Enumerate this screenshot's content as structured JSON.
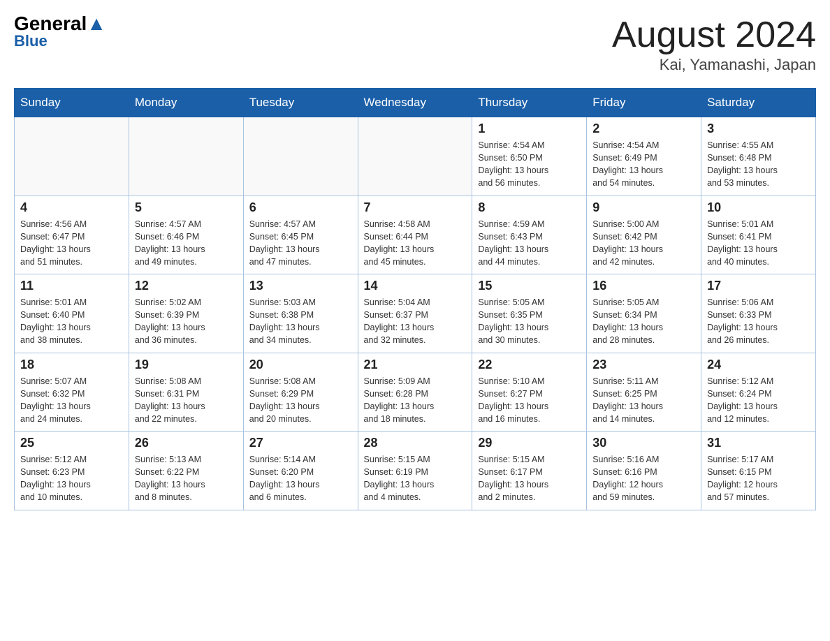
{
  "logo": {
    "line1_black": "General",
    "line1_blue": "Blue",
    "line2": "Blue"
  },
  "title": "August 2024",
  "subtitle": "Kai, Yamanashi, Japan",
  "weekdays": [
    "Sunday",
    "Monday",
    "Tuesday",
    "Wednesday",
    "Thursday",
    "Friday",
    "Saturday"
  ],
  "weeks": [
    [
      {
        "day": "",
        "info": ""
      },
      {
        "day": "",
        "info": ""
      },
      {
        "day": "",
        "info": ""
      },
      {
        "day": "",
        "info": ""
      },
      {
        "day": "1",
        "info": "Sunrise: 4:54 AM\nSunset: 6:50 PM\nDaylight: 13 hours\nand 56 minutes."
      },
      {
        "day": "2",
        "info": "Sunrise: 4:54 AM\nSunset: 6:49 PM\nDaylight: 13 hours\nand 54 minutes."
      },
      {
        "day": "3",
        "info": "Sunrise: 4:55 AM\nSunset: 6:48 PM\nDaylight: 13 hours\nand 53 minutes."
      }
    ],
    [
      {
        "day": "4",
        "info": "Sunrise: 4:56 AM\nSunset: 6:47 PM\nDaylight: 13 hours\nand 51 minutes."
      },
      {
        "day": "5",
        "info": "Sunrise: 4:57 AM\nSunset: 6:46 PM\nDaylight: 13 hours\nand 49 minutes."
      },
      {
        "day": "6",
        "info": "Sunrise: 4:57 AM\nSunset: 6:45 PM\nDaylight: 13 hours\nand 47 minutes."
      },
      {
        "day": "7",
        "info": "Sunrise: 4:58 AM\nSunset: 6:44 PM\nDaylight: 13 hours\nand 45 minutes."
      },
      {
        "day": "8",
        "info": "Sunrise: 4:59 AM\nSunset: 6:43 PM\nDaylight: 13 hours\nand 44 minutes."
      },
      {
        "day": "9",
        "info": "Sunrise: 5:00 AM\nSunset: 6:42 PM\nDaylight: 13 hours\nand 42 minutes."
      },
      {
        "day": "10",
        "info": "Sunrise: 5:01 AM\nSunset: 6:41 PM\nDaylight: 13 hours\nand 40 minutes."
      }
    ],
    [
      {
        "day": "11",
        "info": "Sunrise: 5:01 AM\nSunset: 6:40 PM\nDaylight: 13 hours\nand 38 minutes."
      },
      {
        "day": "12",
        "info": "Sunrise: 5:02 AM\nSunset: 6:39 PM\nDaylight: 13 hours\nand 36 minutes."
      },
      {
        "day": "13",
        "info": "Sunrise: 5:03 AM\nSunset: 6:38 PM\nDaylight: 13 hours\nand 34 minutes."
      },
      {
        "day": "14",
        "info": "Sunrise: 5:04 AM\nSunset: 6:37 PM\nDaylight: 13 hours\nand 32 minutes."
      },
      {
        "day": "15",
        "info": "Sunrise: 5:05 AM\nSunset: 6:35 PM\nDaylight: 13 hours\nand 30 minutes."
      },
      {
        "day": "16",
        "info": "Sunrise: 5:05 AM\nSunset: 6:34 PM\nDaylight: 13 hours\nand 28 minutes."
      },
      {
        "day": "17",
        "info": "Sunrise: 5:06 AM\nSunset: 6:33 PM\nDaylight: 13 hours\nand 26 minutes."
      }
    ],
    [
      {
        "day": "18",
        "info": "Sunrise: 5:07 AM\nSunset: 6:32 PM\nDaylight: 13 hours\nand 24 minutes."
      },
      {
        "day": "19",
        "info": "Sunrise: 5:08 AM\nSunset: 6:31 PM\nDaylight: 13 hours\nand 22 minutes."
      },
      {
        "day": "20",
        "info": "Sunrise: 5:08 AM\nSunset: 6:29 PM\nDaylight: 13 hours\nand 20 minutes."
      },
      {
        "day": "21",
        "info": "Sunrise: 5:09 AM\nSunset: 6:28 PM\nDaylight: 13 hours\nand 18 minutes."
      },
      {
        "day": "22",
        "info": "Sunrise: 5:10 AM\nSunset: 6:27 PM\nDaylight: 13 hours\nand 16 minutes."
      },
      {
        "day": "23",
        "info": "Sunrise: 5:11 AM\nSunset: 6:25 PM\nDaylight: 13 hours\nand 14 minutes."
      },
      {
        "day": "24",
        "info": "Sunrise: 5:12 AM\nSunset: 6:24 PM\nDaylight: 13 hours\nand 12 minutes."
      }
    ],
    [
      {
        "day": "25",
        "info": "Sunrise: 5:12 AM\nSunset: 6:23 PM\nDaylight: 13 hours\nand 10 minutes."
      },
      {
        "day": "26",
        "info": "Sunrise: 5:13 AM\nSunset: 6:22 PM\nDaylight: 13 hours\nand 8 minutes."
      },
      {
        "day": "27",
        "info": "Sunrise: 5:14 AM\nSunset: 6:20 PM\nDaylight: 13 hours\nand 6 minutes."
      },
      {
        "day": "28",
        "info": "Sunrise: 5:15 AM\nSunset: 6:19 PM\nDaylight: 13 hours\nand 4 minutes."
      },
      {
        "day": "29",
        "info": "Sunrise: 5:15 AM\nSunset: 6:17 PM\nDaylight: 13 hours\nand 2 minutes."
      },
      {
        "day": "30",
        "info": "Sunrise: 5:16 AM\nSunset: 6:16 PM\nDaylight: 12 hours\nand 59 minutes."
      },
      {
        "day": "31",
        "info": "Sunrise: 5:17 AM\nSunset: 6:15 PM\nDaylight: 12 hours\nand 57 minutes."
      }
    ]
  ]
}
